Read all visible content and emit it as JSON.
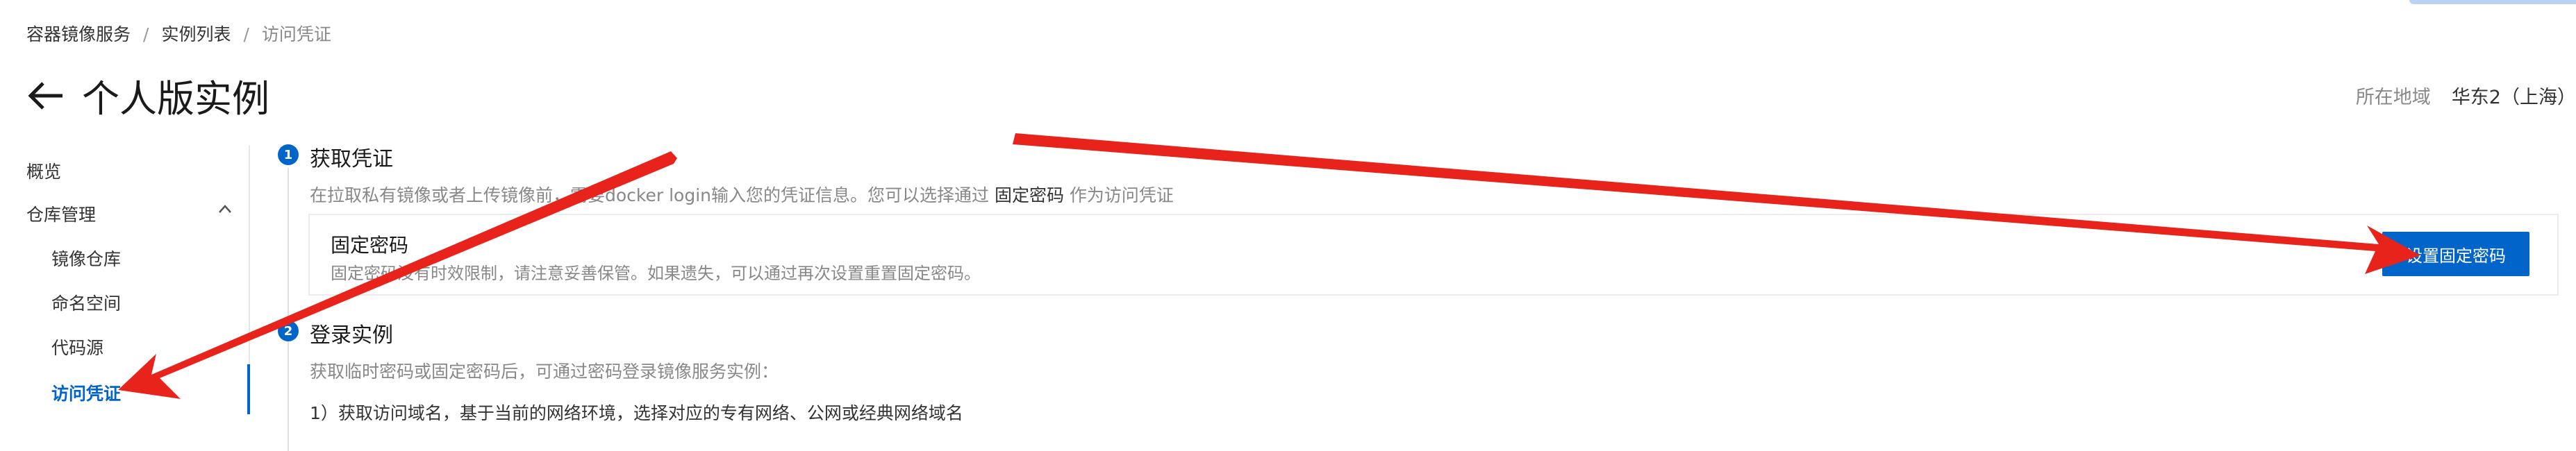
{
  "breadcrumb": {
    "items": [
      "容器镜像服务",
      "实例列表",
      "访问凭证"
    ],
    "separator": "/"
  },
  "header": {
    "title": "个人版实例",
    "region_label": "所在地域",
    "region_value": "华东2（上海）"
  },
  "sidebar": {
    "overview": "概览",
    "repo_management": "仓库管理",
    "image_repo": "镜像仓库",
    "namespace": "命名空间",
    "code_source": "代码源",
    "access_credential": "访问凭证"
  },
  "step1": {
    "number": "1",
    "title": "获取凭证",
    "desc_prefix": "在拉取私有镜像或者上传镜像前，需要docker login输入您的凭证信息。您可以选择通过 ",
    "desc_link": "固定密码",
    "desc_suffix": " 作为访问凭证",
    "card_title": "固定密码",
    "card_desc": "固定密码没有时效限制，请注意妥善保管。如果遗失，可以通过再次设置重置固定密码。",
    "button_label": "设置固定密码"
  },
  "step2": {
    "number": "2",
    "title": "登录实例",
    "desc": "获取临时密码或固定密码后，可通过密码登录镜像服务实例：",
    "item1": "1）获取访问域名，基于当前的网络环境，选择对应的专有网络、公网或经典网络域名"
  },
  "colors": {
    "accent": "#0064c8",
    "annotation_arrow": "#e8231b"
  }
}
